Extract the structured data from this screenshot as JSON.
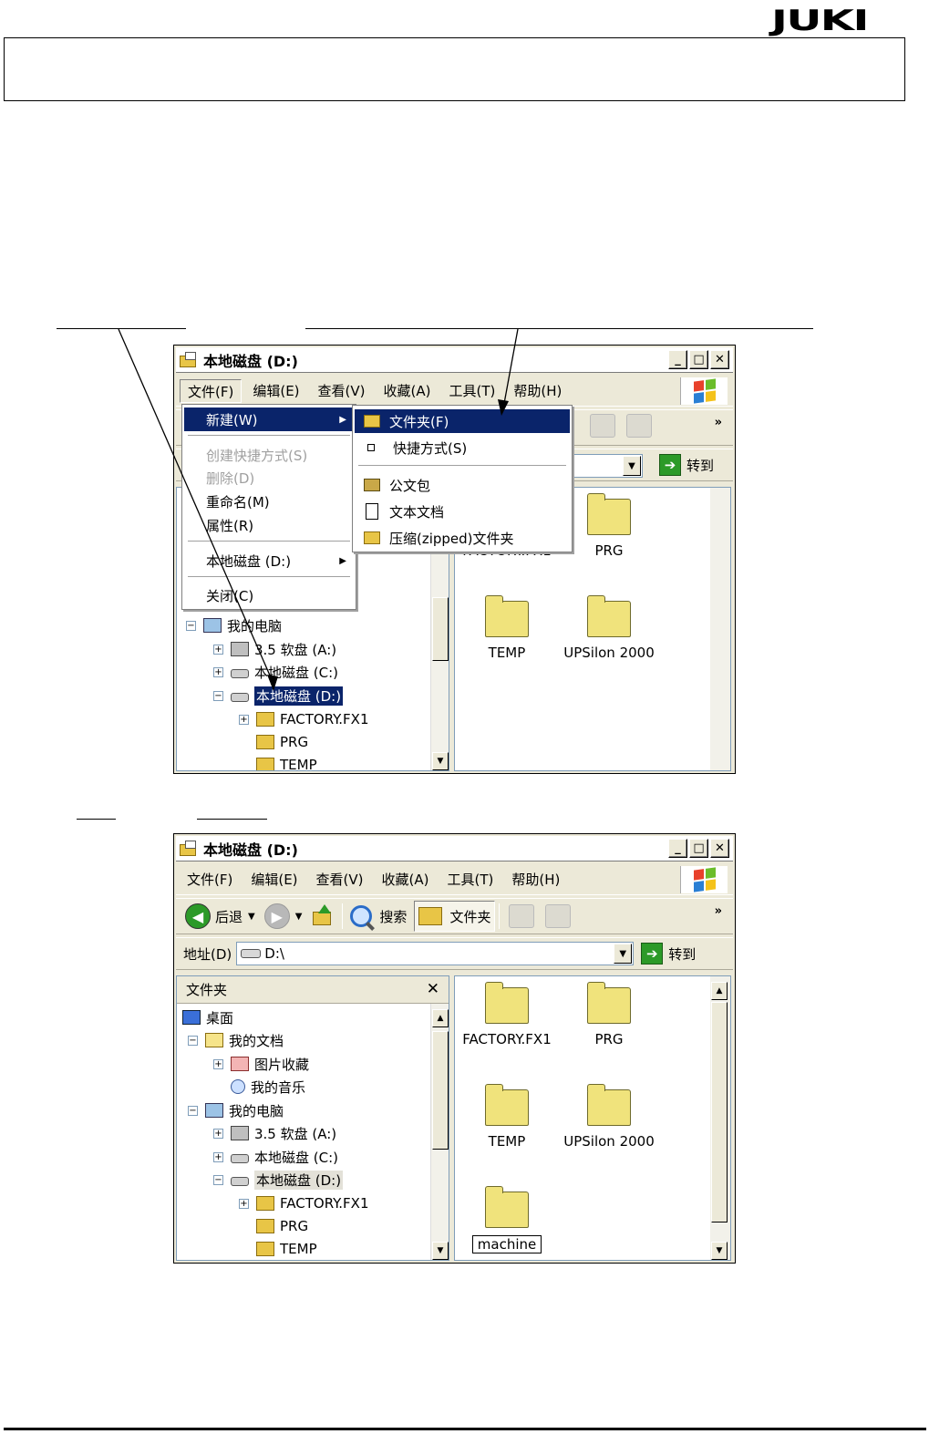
{
  "brand": {
    "logo": "JUKI"
  },
  "window1": {
    "title": "本地磁盘 (D:)",
    "menubar": [
      "文件(F)",
      "编辑(E)",
      "查看(V)",
      "收藏(A)",
      "工具(T)",
      "帮助(H)"
    ],
    "file_menu": {
      "items": [
        {
          "label": "新建(W)",
          "state": "highlighted",
          "submenu": true
        },
        {
          "label": "创建快捷方式(S)",
          "state": "disabled"
        },
        {
          "label": "删除(D)",
          "state": "disabled"
        },
        {
          "label": "重命名(M)",
          "state": "normal"
        },
        {
          "label": "属性(R)",
          "state": "normal"
        },
        {
          "label": "本地磁盘 (D:)",
          "state": "normal",
          "submenu": true
        },
        {
          "label": "关闭(C)",
          "state": "normal"
        }
      ]
    },
    "new_submenu": {
      "items": [
        {
          "label": "文件夹(F)",
          "icon": "folder-icon",
          "state": "highlighted"
        },
        {
          "label": "快捷方式(S)",
          "icon": "shortcut-icon"
        },
        {
          "label": "公文包",
          "icon": "briefcase-icon"
        },
        {
          "label": "文本文档",
          "icon": "text-document-icon"
        },
        {
          "label": "压缩(zipped)文件夹",
          "icon": "zip-folder-icon"
        }
      ]
    },
    "go_label": "转到",
    "tree": [
      "我的电脑",
      "3.5 软盘 (A:)",
      "本地磁盘 (C:)",
      "本地磁盘 (D:)",
      "FACTORY.FX1",
      "PRG",
      "TEMP"
    ],
    "files": [
      "FACTORY.FX1",
      "PRG",
      "TEMP",
      "UPSilon 2000"
    ]
  },
  "window2": {
    "title": "本地磁盘 (D:)",
    "menubar": [
      "文件(F)",
      "编辑(E)",
      "查看(V)",
      "收藏(A)",
      "工具(T)",
      "帮助(H)"
    ],
    "toolbar": {
      "back": "后退",
      "search": "搜索",
      "folders": "文件夹"
    },
    "address": {
      "label": "地址(D)",
      "value": "D:\\",
      "go_label": "转到"
    },
    "folder_pane_title": "文件夹",
    "tree": [
      "桌面",
      "我的文档",
      "图片收藏",
      "我的音乐",
      "我的电脑",
      "3.5 软盘 (A:)",
      "本地磁盘 (C:)",
      "本地磁盘 (D:)",
      "FACTORY.FX1",
      "PRG",
      "TEMP"
    ],
    "files": [
      "FACTORY.FX1",
      "PRG",
      "TEMP",
      "UPSilon 2000",
      "machine"
    ]
  },
  "colors": {
    "selection": "#0a246a",
    "window_face": "#ece9d8",
    "folder": "#f0e37c"
  }
}
